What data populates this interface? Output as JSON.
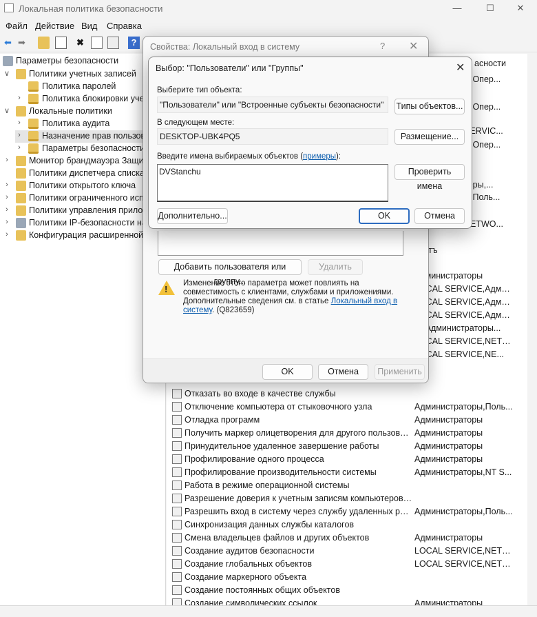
{
  "window": {
    "title": "Локальная политика безопасности"
  },
  "menu": [
    "Файл",
    "Действие",
    "Вид",
    "Справка"
  ],
  "tree": {
    "root": "Параметры безопасности",
    "account_policies": "Политики учетных записей",
    "password_policy": "Политика паролей",
    "lockout_policy": "Политика блокировки уче",
    "local_policies": "Локальные политики",
    "audit_policy": "Политика аудита",
    "user_rights": "Назначение прав пользова",
    "security_options": "Параметры безопасности",
    "firewall": "Монитор брандмауэра Защит",
    "netlist": "Политики диспетчера списка",
    "pubkey": "Политики открытого ключа",
    "restriction": "Политики ограниченного исп",
    "applocker": "Политики управления прилож",
    "ipsec": "Политики IP-безопасности на",
    "advanced_audit": "Конфигурация расширенной"
  },
  "list": {
    "header_right": "асности",
    "top_settings": [
      "ы,Опер...",
      "ы,Опер...",
      "SERVIC...",
      "ы,Опер...",
      "",
      "",
      "тёры,...",
      "ы,Поль...",
      "",
      "NETWO...",
      "тъ"
    ],
    "rows": [
      {
        "name": "",
        "setting": "Администраторы"
      },
      {
        "name": "",
        "setting": "LOCAL SERVICE,Админ..."
      },
      {
        "name": "",
        "setting": "LOCAL SERVICE,Админ..."
      },
      {
        "name": "",
        "setting": "LOCAL SERVICE,Админ..."
      },
      {
        "name": "",
        "setting": "ть,Администраторы..."
      },
      {
        "name": "",
        "setting": "LOCAL SERVICE,NETWO..."
      },
      {
        "name": "",
        "setting": "LOCAL SERVICE,NE..."
      },
      {
        "name": "",
        "setting": "ть"
      },
      {
        "name": "Отказать во входе в качестве службы",
        "setting": ""
      },
      {
        "name": "Отключение компьютера от стыковочного узла",
        "setting": "Администраторы,Поль..."
      },
      {
        "name": "Отладка программ",
        "setting": "Администраторы"
      },
      {
        "name": "Получить маркер олицетворения для другого пользоват...",
        "setting": "Администраторы"
      },
      {
        "name": "Принудительное удаленное завершение работы",
        "setting": "Администраторы"
      },
      {
        "name": "Профилирование одного процесса",
        "setting": "Администраторы"
      },
      {
        "name": "Профилирование производительности системы",
        "setting": "Администраторы,NT S..."
      },
      {
        "name": "Работа в режиме операционной системы",
        "setting": ""
      },
      {
        "name": "Разрешение доверия к учетным записям компьютеров и...",
        "setting": ""
      },
      {
        "name": "Разрешить вход в систему через службу удаленных рабо...",
        "setting": "Администраторы,Поль..."
      },
      {
        "name": "Синхронизация данных службы каталогов",
        "setting": ""
      },
      {
        "name": "Смена владельцев файлов и других объектов",
        "setting": "Администраторы"
      },
      {
        "name": "Создание аудитов безопасности",
        "setting": "LOCAL SERVICE,NETWO..."
      },
      {
        "name": "Создание глобальных объектов",
        "setting": "LOCAL SERVICE,NETWO..."
      },
      {
        "name": "Создание маркерного объекта",
        "setting": ""
      },
      {
        "name": "Создание постоянных общих объектов",
        "setting": ""
      },
      {
        "name": "Создание символических ссылок",
        "setting": "Администраторы"
      }
    ]
  },
  "props_dialog": {
    "title": "Свойства: Локальный вход в систему",
    "help": "?",
    "add_button": "Добавить пользователя или группу...",
    "remove_button": "Удалить",
    "warning_1": "Изменение этого параметра может повлиять на совместимость с клиентами, службами и приложениями. Дополнительные сведения см. в статье ",
    "warning_link": "Локальный вход в систему",
    "warning_2": ". (Q823659)",
    "ok": "OK",
    "cancel": "Отмена",
    "apply": "Применить"
  },
  "select_dialog": {
    "title": "Выбор: \"Пользователи\" или \"Группы\"",
    "type_label": "Выберите тип объекта:",
    "type_value": "\"Пользователи\" или \"Встроенные субъекты безопасности\"",
    "types_button": "Типы объектов...",
    "location_label": "В следующем месте:",
    "location_value": "DESKTOP-UBK4PQ5",
    "location_button": "Размещение...",
    "names_label_1": "Введите имена выбираемых объектов (",
    "names_link": "примеры",
    "names_label_2": "):",
    "names_value": "DVStanchu",
    "check_button": "Проверить имена",
    "advanced_button": "Дополнительно...",
    "ok": "OK",
    "cancel": "Отмена"
  }
}
